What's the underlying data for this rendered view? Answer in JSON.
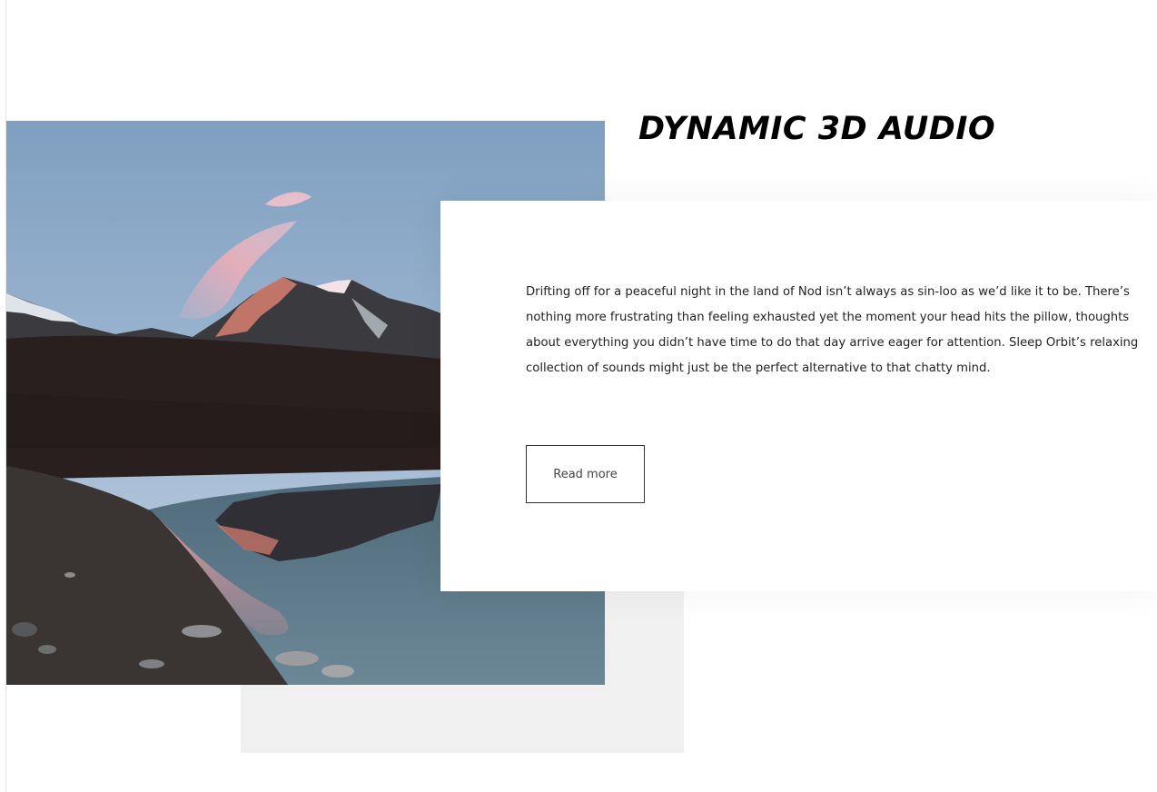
{
  "headline": "DYNAMIC 3D AUDIO",
  "body": "Drifting off for a peaceful night in the land of Nod isn’t always as sin-loo as we’d like it to be. There’s nothing more frustrating than feeling exhausted yet the moment your head hits the pillow, thoughts about everything you didn’t have time to do that day arrive eager for attention. Sleep Orbit’s relaxing collection of sounds might just be the perfect alternative to that chatty mind.",
  "read_more_label": "Read more",
  "colors": {
    "background": "#ffffff",
    "panel_shadow_block": "#f0f0f0",
    "text": "#222222",
    "button_border": "#333333"
  }
}
